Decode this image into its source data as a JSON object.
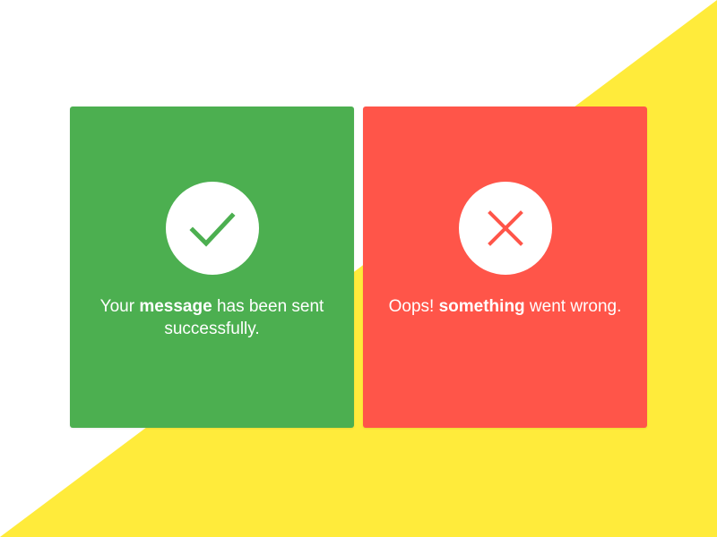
{
  "colors": {
    "background": "#ffffff",
    "accent_yellow": "#ffeb3b",
    "success_green": "#4caf50",
    "error_red": "#ff5549",
    "icon_circle": "#ffffff"
  },
  "success_card": {
    "icon": "checkmark-icon",
    "text_before": "Your ",
    "text_bold": "message",
    "text_after": " has been sent successfully."
  },
  "error_card": {
    "icon": "close-icon",
    "text_before": "Oops! ",
    "text_bold": "something",
    "text_after": " went wrong."
  }
}
